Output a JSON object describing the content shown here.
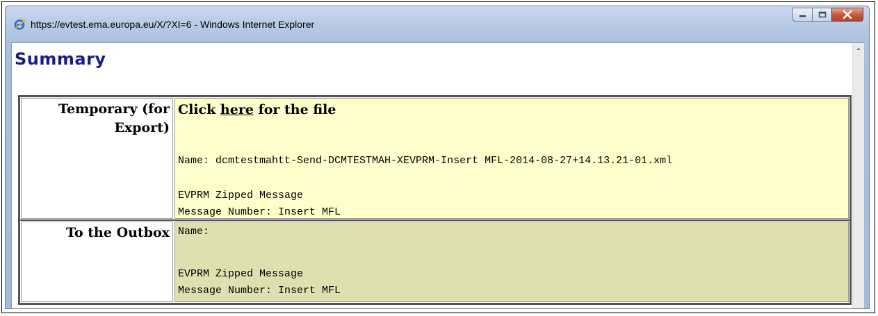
{
  "window": {
    "title": "https://evtest.ema.europa.eu/X/?XI=6 - Windows Internet Explorer"
  },
  "page": {
    "title": "Summary"
  },
  "rows": [
    {
      "label": "Temporary (for Export)",
      "click_prefix": "Click",
      "click_link": "here",
      "click_suffix": "for the file",
      "name_line": "Name: dcmtestmahtt-Send-DCMTESTMAH-XEVPRM-Insert MFL-2014-08-27+14.13.21-01.xml",
      "message_type": "EVPRM Zipped Message",
      "message_number": "Message Number: Insert MFL"
    },
    {
      "label": "To the Outbox",
      "name_line": "Name:",
      "message_type": "EVPRM Zipped Message",
      "message_number": "Message Number: Insert MFL"
    }
  ],
  "colors": {
    "title_blue": "#1a1a8c",
    "row1_bg": "#ffffcc",
    "row2_bg": "#e0dfb0"
  }
}
